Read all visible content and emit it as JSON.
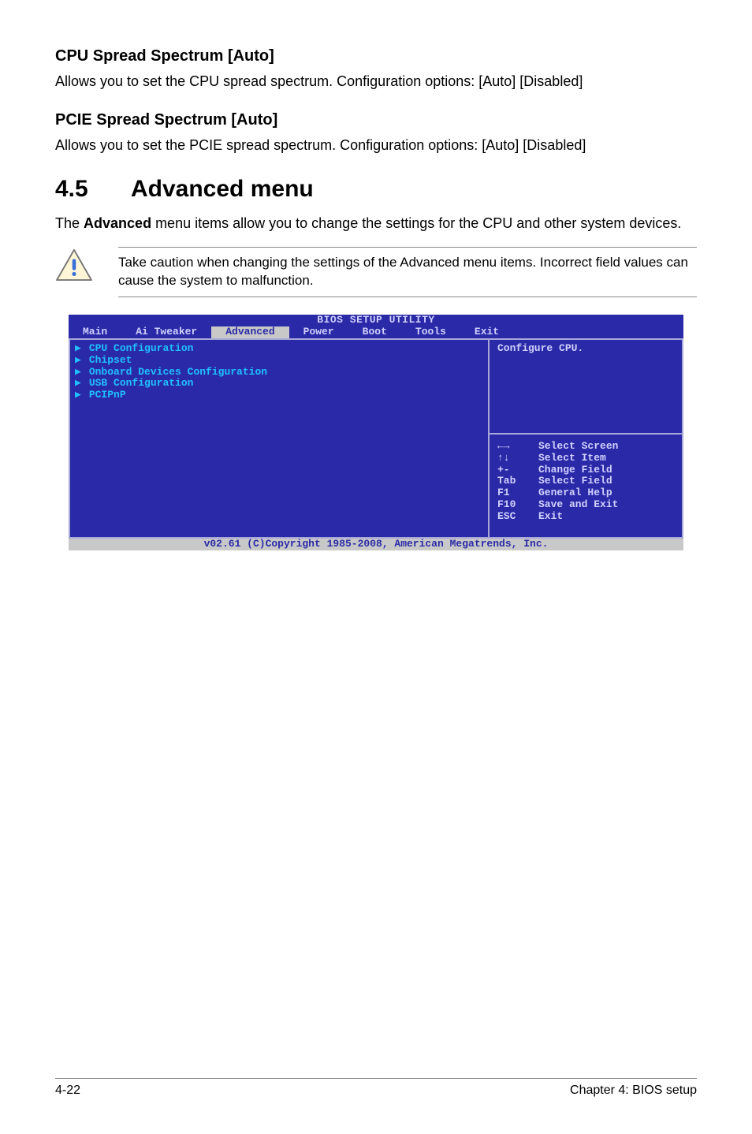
{
  "sec1": {
    "title": "CPU Spread Spectrum [Auto]",
    "body": "Allows you to set the CPU spread spectrum. Configuration options: [Auto] [Disabled]"
  },
  "sec2": {
    "title": "PCIE Spread Spectrum [Auto]",
    "body": "Allows you to set the PCIE spread spectrum. Configuration options: [Auto] [Disabled]"
  },
  "heading": {
    "num": "4.5",
    "title": "Advanced menu"
  },
  "intro_prefix": "The ",
  "intro_bold": "Advanced",
  "intro_suffix": " menu items allow you to change the settings for the CPU and other system devices.",
  "callout": "Take caution when changing the settings of the Advanced menu items. Incorrect field values can cause the system to malfunction.",
  "bios": {
    "title": "BIOS SETUP UTILITY",
    "tabs": [
      "Main",
      "Ai Tweaker",
      "Advanced",
      "Power",
      "Boot",
      "Tools",
      "Exit"
    ],
    "active_tab": "Advanced",
    "left_items": [
      "CPU Configuration",
      "Chipset",
      "Onboard Devices Configuration",
      "USB Configuration",
      "PCIPnP"
    ],
    "help_title": "Configure CPU.",
    "keys": [
      {
        "k": "←→",
        "v": "Select Screen"
      },
      {
        "k": "↑↓",
        "v": "Select Item"
      },
      {
        "k": "+-",
        "v": "Change Field"
      },
      {
        "k": "Tab",
        "v": "Select Field"
      },
      {
        "k": "F1",
        "v": "General Help"
      },
      {
        "k": "F10",
        "v": "Save and Exit"
      },
      {
        "k": "ESC",
        "v": "Exit"
      }
    ],
    "footer": "v02.61 (C)Copyright 1985-2008, American Megatrends, Inc."
  },
  "footer": {
    "left": "4-22",
    "right": "Chapter 4: BIOS setup"
  }
}
